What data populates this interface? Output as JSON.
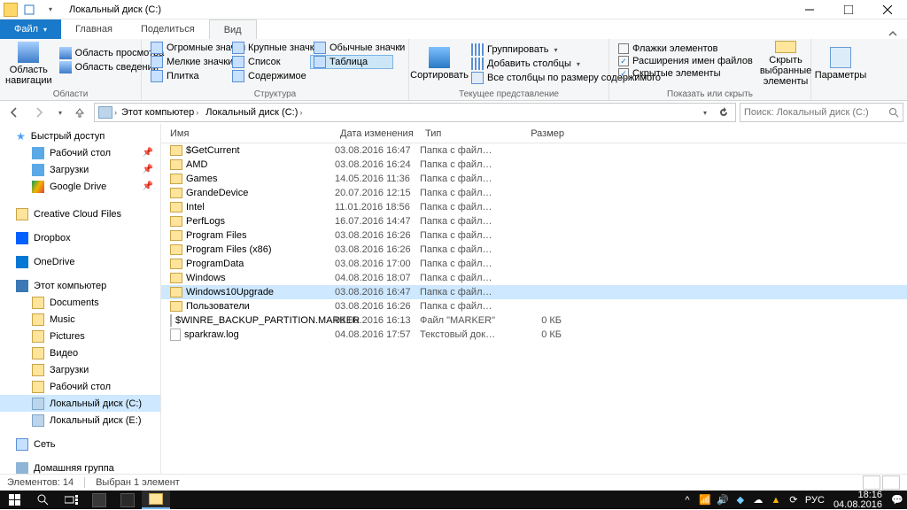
{
  "window": {
    "title": "Локальный диск (C:)"
  },
  "tabs": {
    "file": "Файл",
    "home": "Главная",
    "share": "Поделиться",
    "view": "Вид"
  },
  "ribbon": {
    "panes": {
      "navpane": "Область навигации",
      "preview": "Область просмотра",
      "details": "Область сведений",
      "group": "Области"
    },
    "layout": {
      "huge": "Огромные значки",
      "large": "Крупные значки",
      "medium": "Обычные значки",
      "small": "Мелкие значки",
      "list": "Список",
      "table": "Таблица",
      "tiles": "Плитка",
      "content": "Содержимое",
      "group": "Структура"
    },
    "view": {
      "sort": "Сортировать",
      "groupby": "Группировать",
      "addcols": "Добавить столбцы",
      "fitcols": "Все столбцы по размеру содержимого",
      "group": "Текущее представление"
    },
    "showhide": {
      "chk1": "Флажки элементов",
      "chk2": "Расширения имен файлов",
      "chk3": "Скрытые элементы",
      "hidebtn": "Скрыть выбранные элементы",
      "group": "Показать или скрыть"
    },
    "options": {
      "btn": "Параметры"
    }
  },
  "breadcrumb": {
    "pc": "Этот компьютер",
    "drive": "Локальный диск (C:)"
  },
  "search": {
    "placeholder": "Поиск: Локальный диск (C:)"
  },
  "columns": {
    "name": "Имя",
    "date": "Дата изменения",
    "type": "Тип",
    "size": "Размер"
  },
  "files": [
    {
      "name": "$GetCurrent",
      "date": "03.08.2016 16:47",
      "type": "Папка с файлами",
      "size": "",
      "icon": "folder"
    },
    {
      "name": "AMD",
      "date": "03.08.2016 16:24",
      "type": "Папка с файлами",
      "size": "",
      "icon": "folder"
    },
    {
      "name": "Games",
      "date": "14.05.2016 11:36",
      "type": "Папка с файлами",
      "size": "",
      "icon": "folder"
    },
    {
      "name": "GrandeDevice",
      "date": "20.07.2016 12:15",
      "type": "Папка с файлами",
      "size": "",
      "icon": "folder"
    },
    {
      "name": "Intel",
      "date": "11.01.2016 18:56",
      "type": "Папка с файлами",
      "size": "",
      "icon": "folder"
    },
    {
      "name": "PerfLogs",
      "date": "16.07.2016 14:47",
      "type": "Папка с файлами",
      "size": "",
      "icon": "folder"
    },
    {
      "name": "Program Files",
      "date": "03.08.2016 16:26",
      "type": "Папка с файлами",
      "size": "",
      "icon": "folder"
    },
    {
      "name": "Program Files (x86)",
      "date": "03.08.2016 16:26",
      "type": "Папка с файлами",
      "size": "",
      "icon": "folder"
    },
    {
      "name": "ProgramData",
      "date": "03.08.2016 17:00",
      "type": "Папка с файлами",
      "size": "",
      "icon": "folder"
    },
    {
      "name": "Windows",
      "date": "04.08.2016 18:07",
      "type": "Папка с файлами",
      "size": "",
      "icon": "folder"
    },
    {
      "name": "Windows10Upgrade",
      "date": "03.08.2016 16:47",
      "type": "Папка с файлами",
      "size": "",
      "icon": "folder",
      "selected": true
    },
    {
      "name": "Пользователи",
      "date": "03.08.2016 16:26",
      "type": "Папка с файлами",
      "size": "",
      "icon": "folder"
    },
    {
      "name": "$WINRE_BACKUP_PARTITION.MARKER",
      "date": "03.08.2016 16:13",
      "type": "Файл \"MARKER\"",
      "size": "0 КБ",
      "icon": "file"
    },
    {
      "name": "sparkraw.log",
      "date": "04.08.2016 17:57",
      "type": "Текстовый докум...",
      "size": "0 КБ",
      "icon": "file"
    }
  ],
  "nav": {
    "quick": "Быстрый доступ",
    "desktop": "Рабочий стол",
    "downloads": "Загрузки",
    "gdrive": "Google Drive",
    "ccf": "Creative Cloud Files",
    "dropbox": "Dropbox",
    "onedrive": "OneDrive",
    "thispc": "Этот компьютер",
    "documents": "Documents",
    "music": "Music",
    "pictures": "Pictures",
    "video": "Видео",
    "downloads2": "Загрузки",
    "desktop2": "Рабочий стол",
    "drivec": "Локальный диск (C:)",
    "drivee": "Локальный диск (E:)",
    "network": "Сеть",
    "homegroup": "Домашняя группа"
  },
  "status": {
    "count": "Элементов: 14",
    "selection": "Выбран 1 элемент"
  },
  "taskbar": {
    "lang": "РУС",
    "time": "18:16",
    "date": "04.08.2016"
  }
}
